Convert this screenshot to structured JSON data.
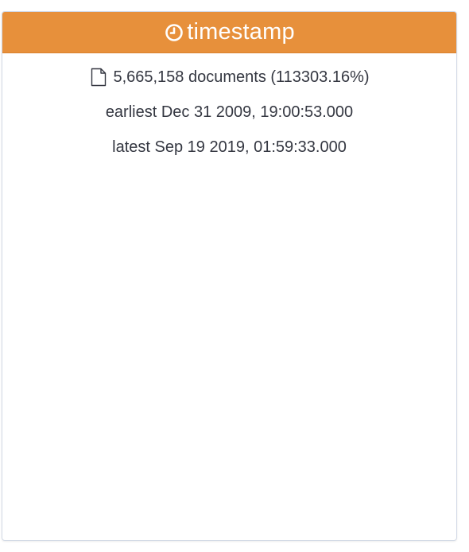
{
  "card": {
    "title": "timestamp",
    "header_icon": "clock-icon",
    "header_color": "#e7903b",
    "doc_icon": "document-icon",
    "documents": "5,665,158 documents (113303.16%)",
    "earliest_label": "earliest",
    "earliest_value": "Dec 31 2009, 19:00:53.000",
    "latest_label": "latest",
    "latest_value": "Sep 19 2019, 01:59:33.000"
  }
}
